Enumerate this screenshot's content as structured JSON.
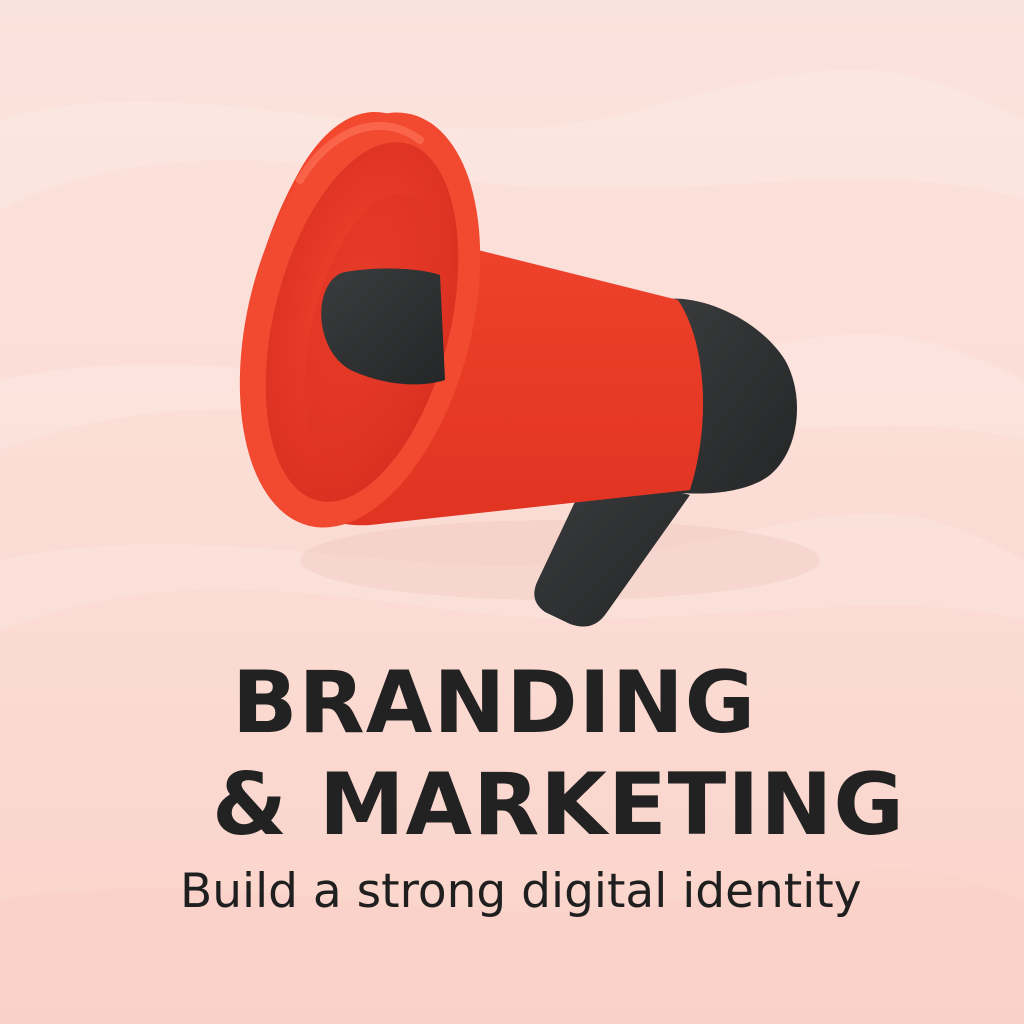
{
  "poster": {
    "headline_line1": "BRANDING",
    "headline_line2": "& MARKETING",
    "tagline": "Build a strong digital identity"
  },
  "colors": {
    "background": "#fbe0d9",
    "megaphone_red": "#ee3b2a",
    "megaphone_dark": "#2f3132",
    "text": "#222222"
  },
  "icons": [
    "megaphone-icon"
  ]
}
